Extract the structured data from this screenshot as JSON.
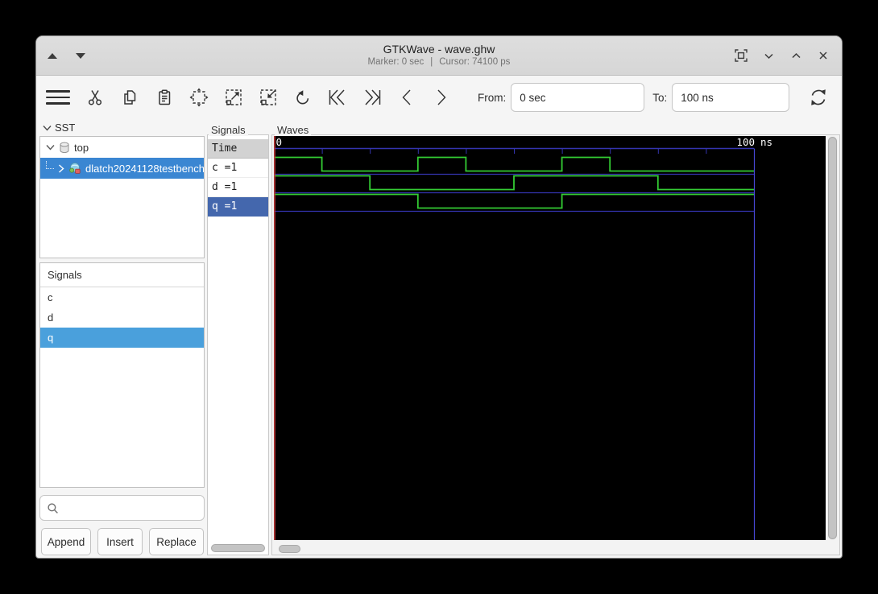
{
  "titlebar": {
    "title": "GTKWave - wave.ghw",
    "marker_status": "Marker: 0 sec",
    "separator": "|",
    "cursor_status": "Cursor: 74100 ps"
  },
  "toolbar": {
    "from_label": "From:",
    "from_value": "0 sec",
    "to_label": "To:",
    "to_value": "100 ns",
    "icons": [
      "menu",
      "cut",
      "copy",
      "paste",
      "zoom-fit",
      "zoom-in",
      "zoom-out",
      "undo",
      "skip-to-start",
      "skip-to-end",
      "step-left",
      "step-right",
      "reload"
    ]
  },
  "left_panel": {
    "sst_header": "SST",
    "tree": {
      "root_label": "top",
      "child_label": "dlatch20241128testbench"
    },
    "signals_header": "Signals",
    "signals": [
      "c",
      "d",
      "q"
    ],
    "selected_signal": "q",
    "search_placeholder": "",
    "buttons": {
      "append": "Append",
      "insert": "Insert",
      "replace": "Replace"
    }
  },
  "signals_column": {
    "frame_label": "Signals",
    "time_header": "Time",
    "selected_row": "q =1"
  },
  "waves_panel": {
    "frame_label": "Waves"
  },
  "chart_data": {
    "type": "line",
    "subtype": "digital-waveform",
    "title": "GHW waveform viewer traces",
    "x_unit": "ns",
    "x_range": [
      0,
      100
    ],
    "tick_interval_ns": 10,
    "timeline_left_label": "0",
    "timeline_right_label": "100 ns",
    "marker_time_ns": 0,
    "series": [
      {
        "name": "c",
        "label": "c =1",
        "current_value": 1,
        "end_time_ns": 100,
        "transitions": [
          {
            "t": 0,
            "v": 1
          },
          {
            "t": 10,
            "v": 0
          },
          {
            "t": 30,
            "v": 1
          },
          {
            "t": 40,
            "v": 0
          },
          {
            "t": 60,
            "v": 1
          },
          {
            "t": 70,
            "v": 0
          }
        ]
      },
      {
        "name": "d",
        "label": "d =1",
        "current_value": 1,
        "end_time_ns": 100,
        "transitions": [
          {
            "t": 0,
            "v": 1
          },
          {
            "t": 20,
            "v": 0
          },
          {
            "t": 50,
            "v": 1
          },
          {
            "t": 80,
            "v": 0
          }
        ]
      },
      {
        "name": "q",
        "label": "q =1",
        "current_value": 1,
        "end_time_ns": 100,
        "transitions": [
          {
            "t": 0,
            "v": 1
          },
          {
            "t": 30,
            "v": 0
          },
          {
            "t": 60,
            "v": 1
          }
        ]
      }
    ],
    "colors": {
      "wave_green": "#33cc33",
      "grid_navy": "#3434b0",
      "end_line_blue": "#4848d8",
      "marker_red": "#cc3c3c",
      "background": "#000000",
      "label_text": "#ffffff"
    }
  },
  "colors": {
    "tree_selection": "#3a86d2",
    "list_selection": "#4aa0dc",
    "column_selection": "#4467ad",
    "titlebar_bg": "#dadada"
  }
}
